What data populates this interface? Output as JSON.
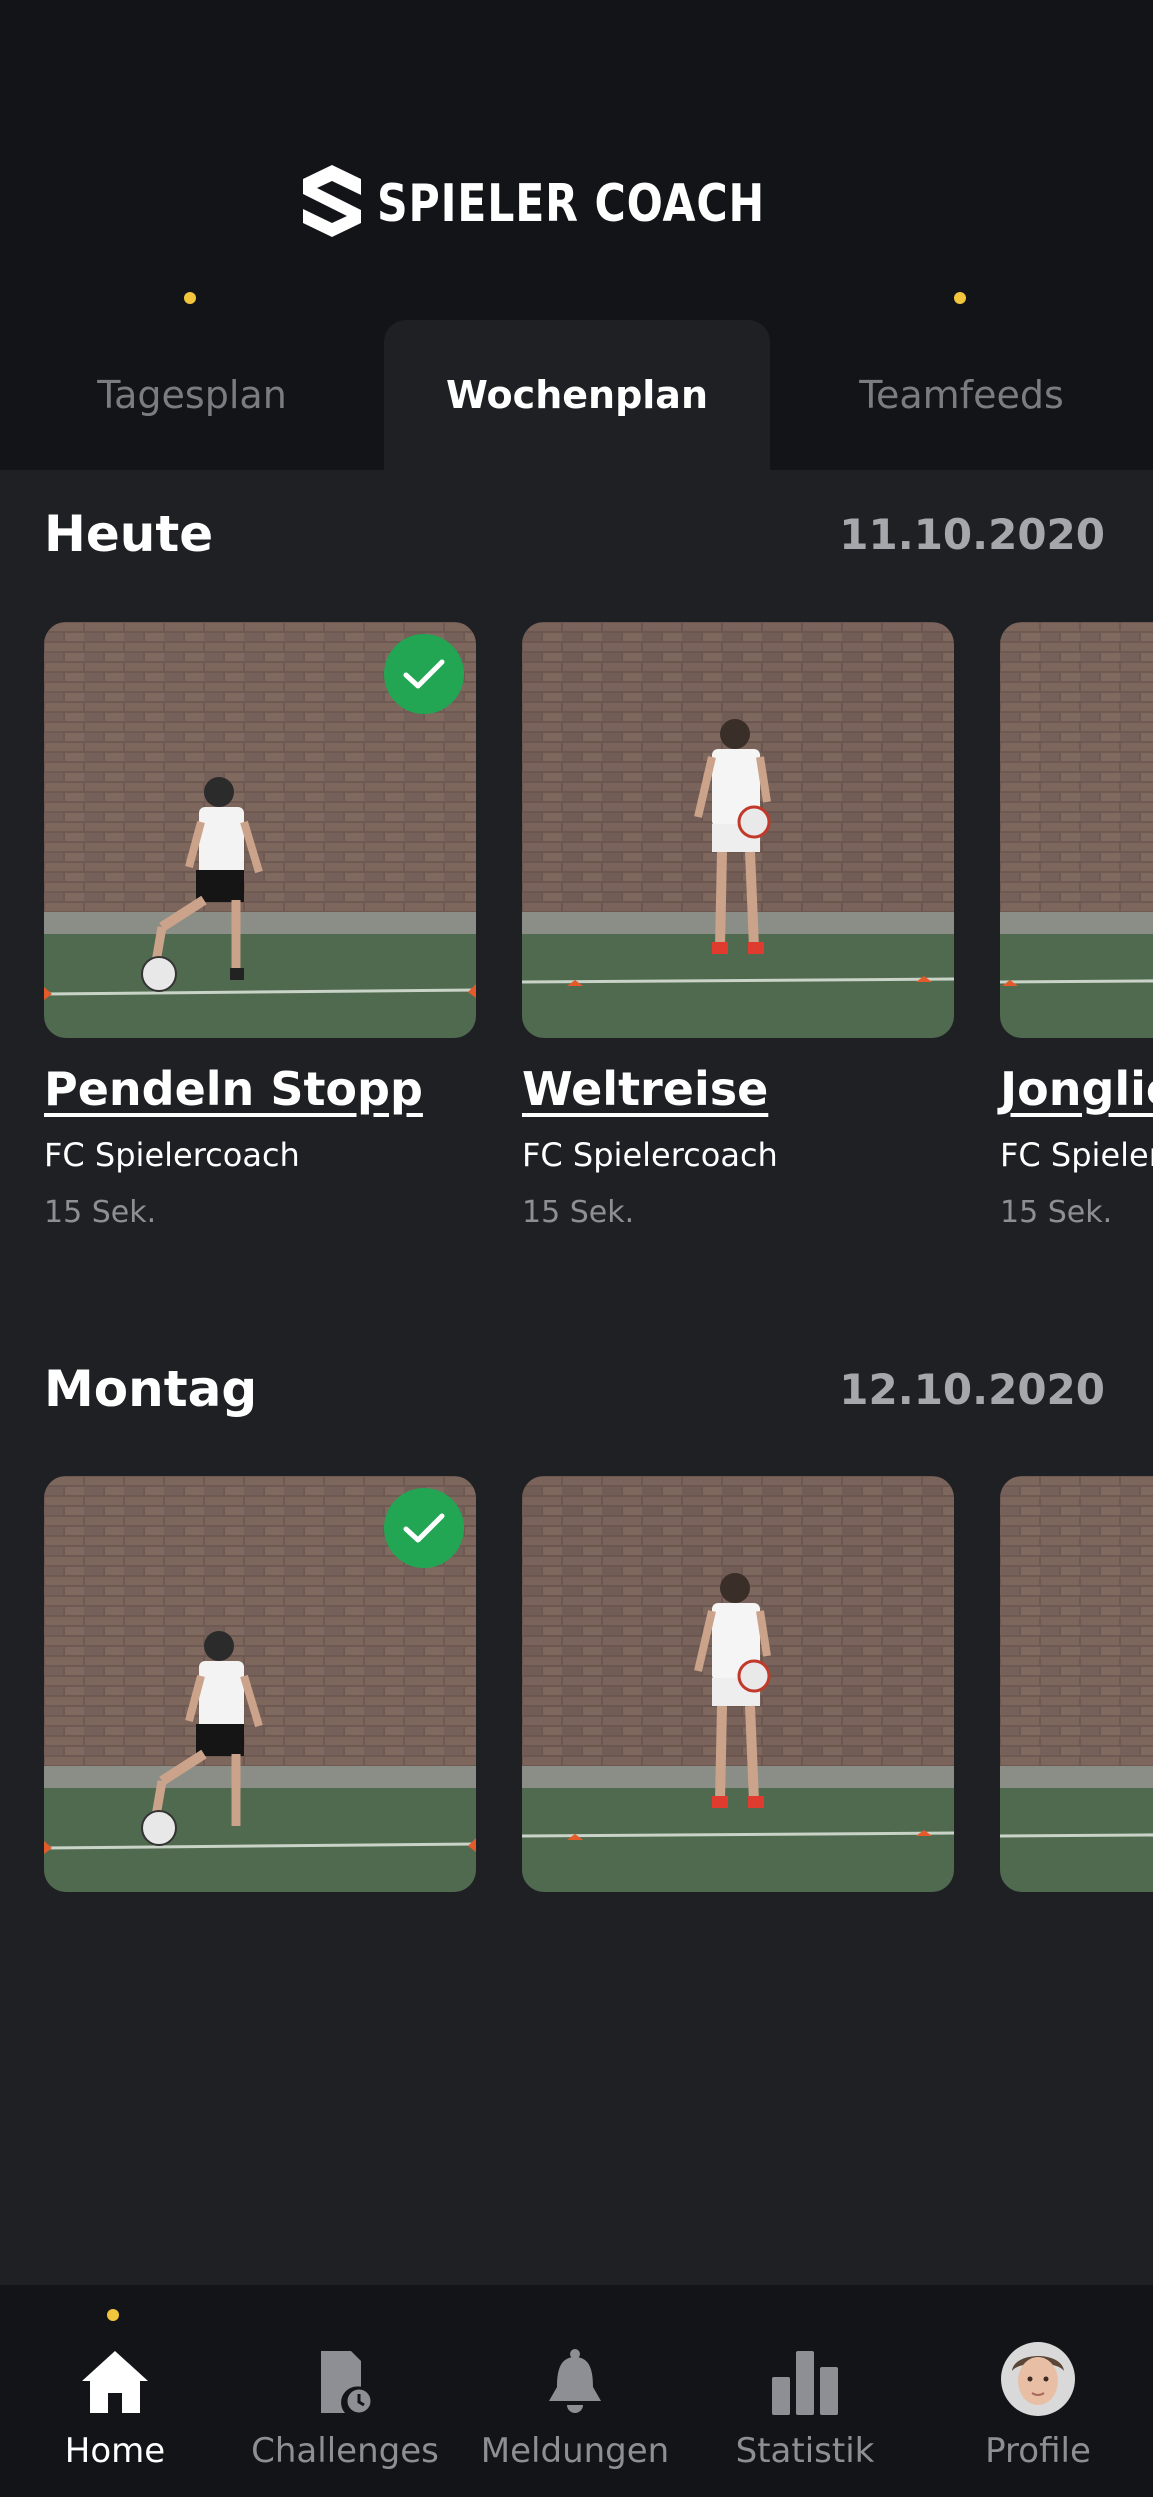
{
  "app": {
    "brand": "SPIELER COACH",
    "accent_color": "#f2c53d",
    "check_color": "#22a653"
  },
  "tabs": [
    {
      "label": "Tagesplan",
      "active": false,
      "notification_dot": true
    },
    {
      "label": "Wochenplan",
      "active": true,
      "notification_dot": false
    },
    {
      "label": "Teamfeeds",
      "active": false,
      "notification_dot": true
    }
  ],
  "sections": [
    {
      "title": "Heute",
      "date": "11.10.2020",
      "cards": [
        {
          "title": "Pendeln Stopp",
          "club": "FC Spielercoach",
          "duration": "15 Sek.",
          "completed": true
        },
        {
          "title": "Weltreise",
          "club": "FC Spielercoach",
          "duration": "15 Sek.",
          "completed": false
        },
        {
          "title": "Jonglieren",
          "club": "FC Spielercoach",
          "duration": "15 Sek.",
          "completed": false
        }
      ]
    },
    {
      "title": "Montag",
      "date": "12.10.2020",
      "cards": [
        {
          "completed": true
        },
        {
          "completed": false
        },
        {
          "completed": false
        }
      ]
    }
  ],
  "bottom_nav": [
    {
      "label": "Home",
      "icon": "home-icon",
      "active": true
    },
    {
      "label": "Challenges",
      "icon": "challenges-icon",
      "active": false
    },
    {
      "label": "Meldungen",
      "icon": "bell-icon",
      "active": false
    },
    {
      "label": "Statistik",
      "icon": "bar-chart-icon",
      "active": false
    },
    {
      "label": "Profile",
      "icon": "avatar",
      "active": false
    }
  ]
}
